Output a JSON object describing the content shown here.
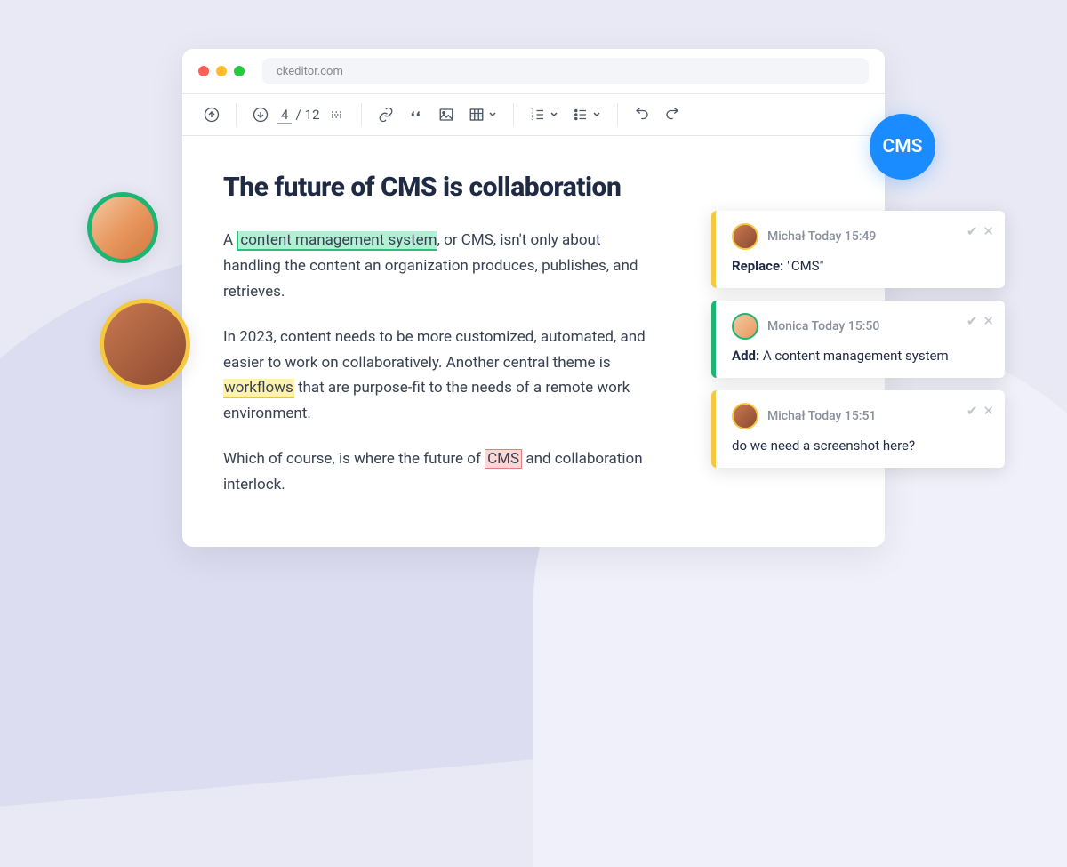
{
  "url": "ckeditor.com",
  "badge": "CMS",
  "toolbar": {
    "page_current": "4",
    "page_total": "12"
  },
  "document": {
    "title": "The future of CMS is collaboration",
    "p1_pre": "A ",
    "p1_hl": "content management system",
    "p1_post": ", or CMS, isn't only about handling the content an organization produces, publishes, and retrieves.",
    "p2_pre": "In 2023, content needs to be more customized, automated, and easier to work on collaboratively. Another central theme is ",
    "p2_hl": "workflows",
    "p2_post": " that are purpose-fit to the needs of a remote work environment.",
    "p3_pre": "Which of course, is where the future of ",
    "p3_hl": "CMS",
    "p3_post": " and collaboration interlock."
  },
  "comments": [
    {
      "author": "Michał",
      "time": "Today 15:49",
      "action": "Replace:",
      "text": " \"CMS\""
    },
    {
      "author": "Monica",
      "time": "Today 15:50",
      "action": "Add:",
      "text": " A content management system"
    },
    {
      "author": "Michał",
      "time": "Today 15:51",
      "action": "",
      "text": "do we need a screenshot here?"
    }
  ]
}
